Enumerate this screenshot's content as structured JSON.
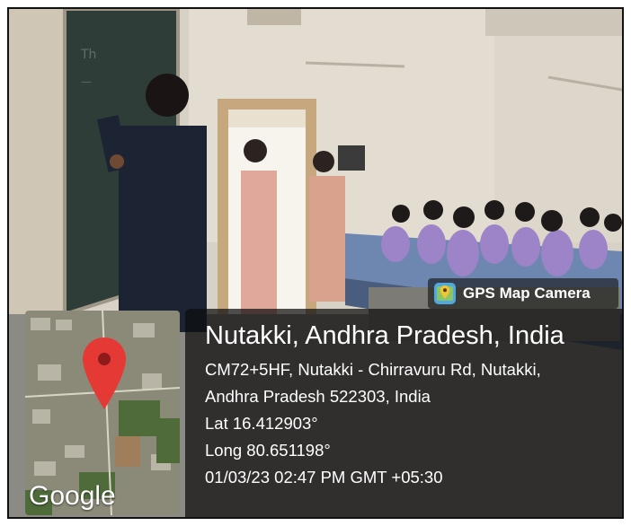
{
  "badge": {
    "label": "GPS Map Camera",
    "icon": "map-pin-app-icon"
  },
  "map": {
    "logo": "Google",
    "pin_icon": "location-pin-icon"
  },
  "location": {
    "title": "Nutakki, Andhra Pradesh, India",
    "address_line1": "CM72+5HF, Nutakki - Chirravuru Rd, Nutakki,",
    "address_line2": "Andhra Pradesh 522303, India",
    "lat": "Lat 16.412903°",
    "long": "Long 80.651198°",
    "datetime": "01/03/23 02:47 PM GMT +05:30"
  },
  "colors": {
    "pin": "#e53935",
    "badge_bg": "#141414",
    "overlay": "#0c0c0c"
  }
}
